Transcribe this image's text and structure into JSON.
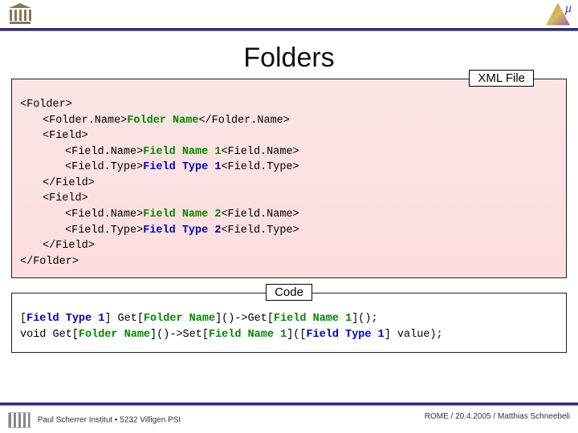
{
  "title": "Folders",
  "labels": {
    "xml": "XML File",
    "code": "Code"
  },
  "xml": {
    "l1": "<Folder>",
    "l2a": "<Folder.Name>",
    "l2b": "Folder Name",
    "l2c": "</Folder.Name>",
    "l3": "<Field>",
    "l4a": "<Field.Name>",
    "l4b": "Field Name 1",
    "l4c": "<Field.Name>",
    "l5a": "<Field.Type>",
    "l5b": "Field Type 1",
    "l5c": "<Field.Type>",
    "l6": "</Field>",
    "l7": "<Field>",
    "l8a": "<Field.Name>",
    "l8b": "Field Name 2",
    "l8c": "<Field.Name>",
    "l9a": "<Field.Type>",
    "l9b": "Field Type 2",
    "l9c": "<Field.Type>",
    "l10": "</Field>",
    "l11": "</Folder>"
  },
  "code": {
    "line1": {
      "p1": "[",
      "ft1": "Field Type 1",
      "p2": "] Get[",
      "fn": "Folder Name",
      "p3": "]()->Get[",
      "fld": "Field Name 1",
      "p4": "]();"
    },
    "line2": {
      "p1": "void Get[",
      "fn": "Folder Name",
      "p2": "]()->Set[",
      "fld": "Field Name 1",
      "p3": "]([",
      "ft1": "Field Type 1",
      "p4": "] value);"
    }
  },
  "footer": {
    "left": "Paul Scherrer Institut • 5232 Villigen PSI",
    "right": "ROME / 20.4.2005 / Matthias Schneebeli"
  }
}
